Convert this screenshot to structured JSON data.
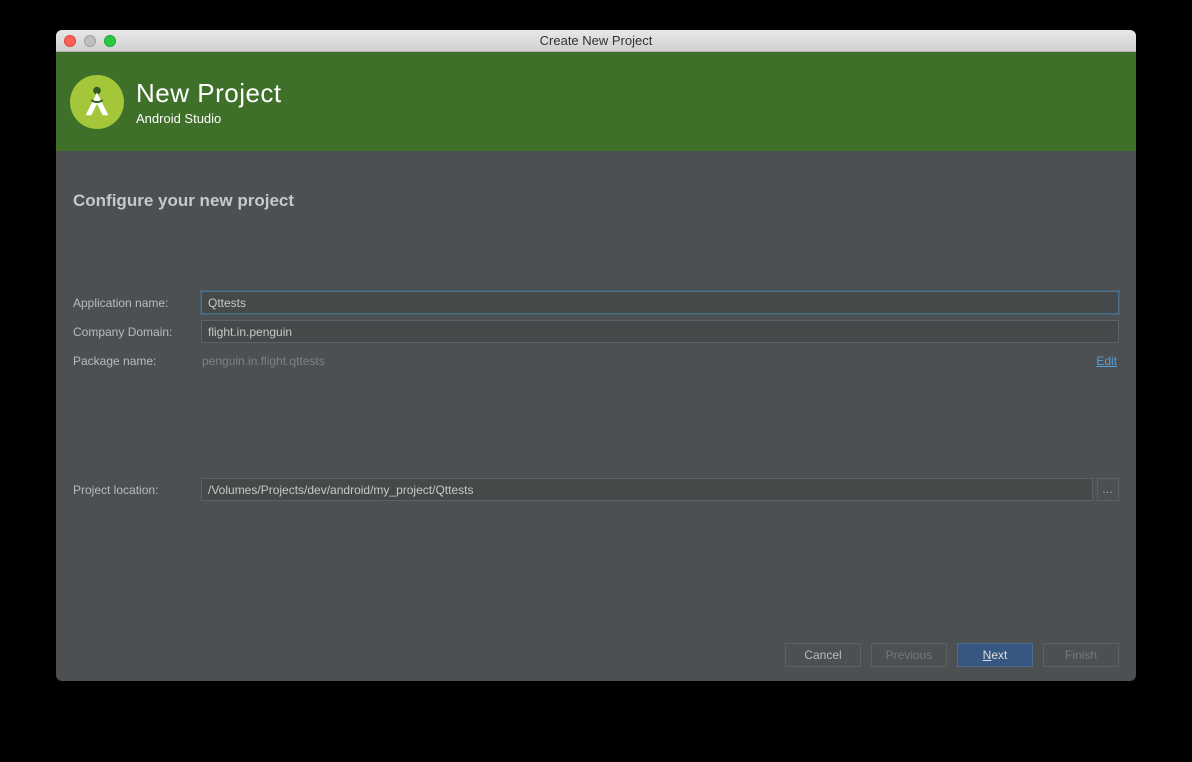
{
  "titlebar": {
    "title": "Create New Project"
  },
  "header": {
    "title": "New Project",
    "subtitle": "Android Studio"
  },
  "section": {
    "title": "Configure your new project"
  },
  "form": {
    "app_name_label": "Application name:",
    "app_name_value": "Qttests",
    "company_domain_label": "Company Domain:",
    "company_domain_value": "flight.in.penguin",
    "package_name_label": "Package name:",
    "package_name_value": "penguin.in.flight.qttests",
    "edit_label": "Edit",
    "project_location_label": "Project location:",
    "project_location_value": "/Volumes/Projects/dev/android/my_project/Qttests",
    "browse_label": "…"
  },
  "footer": {
    "cancel": "Cancel",
    "previous": "Previous",
    "next_prefix": "N",
    "next_suffix": "ext",
    "finish": "Finish"
  }
}
